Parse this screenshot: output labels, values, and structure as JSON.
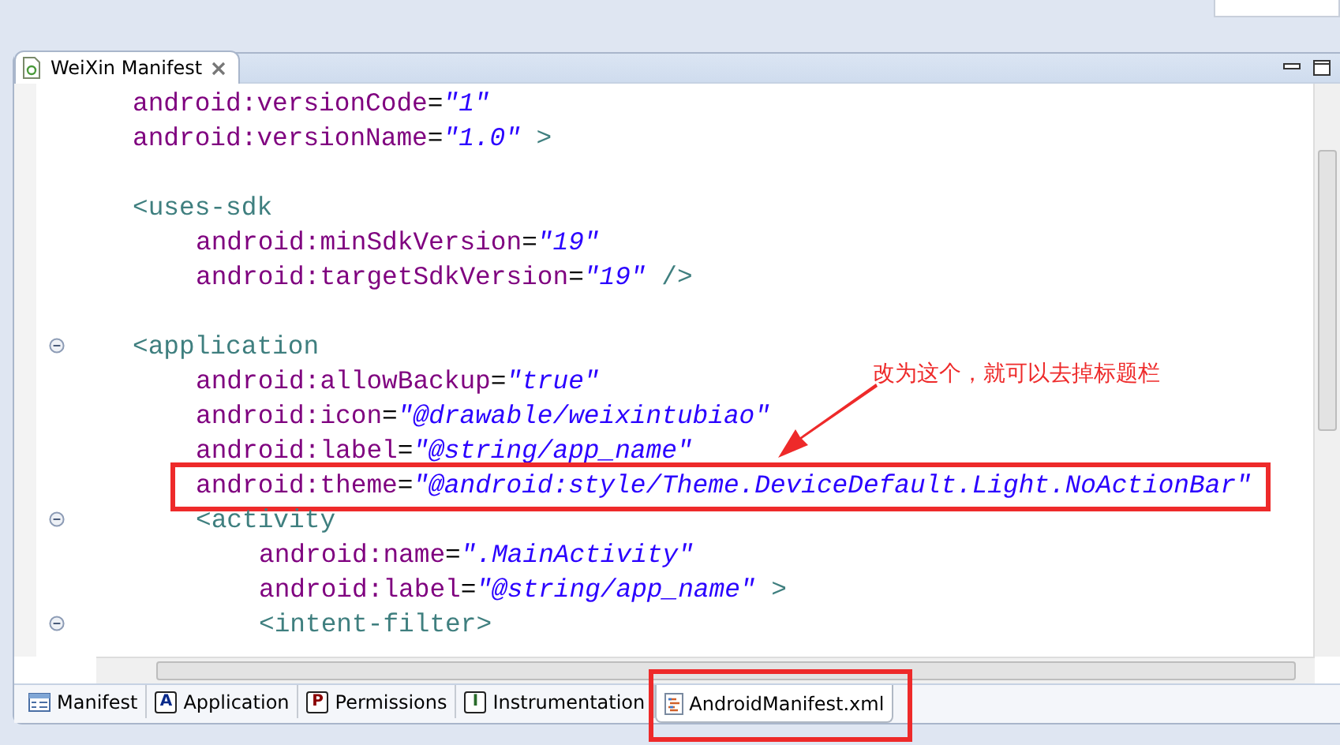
{
  "editor_tab": {
    "title": "WeiXin Manifest"
  },
  "code": [
    {
      "kind": "code",
      "tokens": [
        {
          "kind": "attr",
          "text": "android:versionCode"
        },
        {
          "kind": "eq",
          "text": "="
        },
        {
          "kind": "value",
          "text": "\"1\""
        }
      ]
    },
    {
      "kind": "code",
      "tokens": [
        {
          "kind": "attr",
          "text": "android:versionName"
        },
        {
          "kind": "eq",
          "text": "="
        },
        {
          "kind": "value",
          "text": "\"1.0\""
        },
        {
          "kind": "tag",
          "text": " >"
        }
      ]
    },
    {
      "kind": "blank"
    },
    {
      "kind": "code",
      "tokens": [
        {
          "kind": "tag",
          "text": "<uses-sdk"
        }
      ],
      "children": [
        {
          "kind": "code",
          "tokens": [
            {
              "kind": "attr",
              "text": "android:minSdkVersion"
            },
            {
              "kind": "eq",
              "text": "="
            },
            {
              "kind": "value",
              "text": "\"19\""
            }
          ]
        },
        {
          "kind": "code",
          "tokens": [
            {
              "kind": "attr",
              "text": "android:targetSdkVersion"
            },
            {
              "kind": "eq",
              "text": "="
            },
            {
              "kind": "value",
              "text": "\"19\""
            },
            {
              "kind": "tag",
              "text": " />"
            }
          ]
        }
      ]
    },
    {
      "kind": "blank"
    },
    {
      "kind": "code",
      "fold": true,
      "tokens": [
        {
          "kind": "tag",
          "text": "<application"
        }
      ],
      "children": [
        {
          "kind": "code",
          "tokens": [
            {
              "kind": "attr",
              "text": "android:allowBackup"
            },
            {
              "kind": "eq",
              "text": "="
            },
            {
              "kind": "value",
              "text": "\"true\""
            }
          ]
        },
        {
          "kind": "code",
          "tokens": [
            {
              "kind": "attr",
              "text": "android:icon"
            },
            {
              "kind": "eq",
              "text": "="
            },
            {
              "kind": "value",
              "text": "\"@drawable/weixintubiao\""
            }
          ]
        },
        {
          "kind": "code",
          "tokens": [
            {
              "kind": "attr",
              "text": "android:label"
            },
            {
              "kind": "eq",
              "text": "="
            },
            {
              "kind": "value",
              "text": "\"@string/app_name\""
            }
          ]
        },
        {
          "kind": "code",
          "highlighted": true,
          "tokens": [
            {
              "kind": "attr",
              "text": "android:theme"
            },
            {
              "kind": "eq",
              "text": "="
            },
            {
              "kind": "value",
              "text": "\"@android:style/Theme.DeviceDefault.Light.NoActionBar\""
            }
          ]
        },
        {
          "kind": "code",
          "fold": true,
          "tokens": [
            {
              "kind": "tag",
              "text": "<activity"
            }
          ],
          "children": [
            {
              "kind": "code",
              "tokens": [
                {
                  "kind": "attr",
                  "text": "android:name"
                },
                {
                  "kind": "eq",
                  "text": "="
                },
                {
                  "kind": "value",
                  "text": "\".MainActivity\""
                }
              ]
            },
            {
              "kind": "code",
              "tokens": [
                {
                  "kind": "attr",
                  "text": "android:label"
                },
                {
                  "kind": "eq",
                  "text": "="
                },
                {
                  "kind": "value",
                  "text": "\"@string/app_name\""
                },
                {
                  "kind": "tag",
                  "text": " >"
                }
              ]
            },
            {
              "kind": "code",
              "fold": true,
              "tokens": [
                {
                  "kind": "tag",
                  "text": "<intent-filter>"
                }
              ]
            }
          ]
        }
      ]
    }
  ],
  "annotation": {
    "text": "改为这个，就可以去掉标题栏"
  },
  "page_tabs": [
    {
      "kind": "form",
      "label": "Manifest",
      "selected": false
    },
    {
      "kind": "letter",
      "letter": "A",
      "label": "Application",
      "selected": false
    },
    {
      "kind": "letter",
      "letter": "P",
      "label": "Permissions",
      "selected": false
    },
    {
      "kind": "letter",
      "letter": "I",
      "label": "Instrumentation",
      "selected": false
    },
    {
      "kind": "xml",
      "label": "AndroidManifest.xml",
      "selected": true,
      "highlighted": true
    }
  ]
}
